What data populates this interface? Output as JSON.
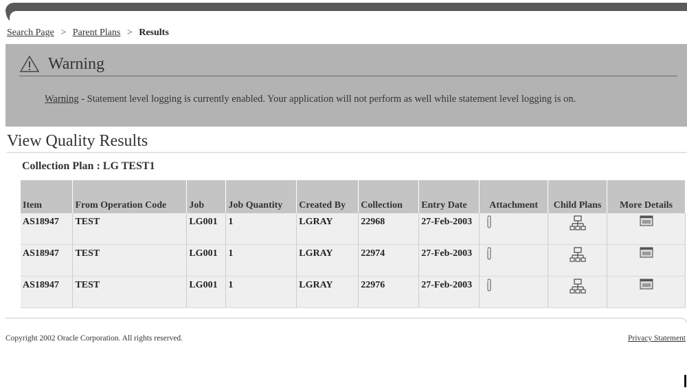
{
  "breadcrumb": {
    "items": [
      "Search Page",
      "Parent Plans"
    ],
    "separator": ">",
    "current": "Results"
  },
  "warning": {
    "title": "Warning",
    "label": "Warning",
    "message": " - Statement level logging is currently enabled. Your application will not perform as well while statement level logging is on."
  },
  "page": {
    "title": "View Quality Results",
    "subtitle": "Collection Plan : LG TEST1"
  },
  "table": {
    "headers": [
      "Item",
      "From Operation Code",
      "Job",
      "Job Quantity",
      "Created By",
      "Collection",
      "Entry Date",
      "Attachment",
      "Child Plans",
      "More Details"
    ],
    "rows": [
      {
        "item": "AS18947",
        "op_code": "TEST",
        "job": "LG001",
        "qty": "1",
        "created_by": "LGRAY",
        "collection": "22968",
        "entry_date": "27-Feb-2003"
      },
      {
        "item": "AS18947",
        "op_code": "TEST",
        "job": "LG001",
        "qty": "1",
        "created_by": "LGRAY",
        "collection": "22974",
        "entry_date": "27-Feb-2003"
      },
      {
        "item": "AS18947",
        "op_code": "TEST",
        "job": "LG001",
        "qty": "1",
        "created_by": "LGRAY",
        "collection": "22976",
        "entry_date": "27-Feb-2003"
      }
    ]
  },
  "footer": {
    "copyright": "Copyright 2002 Oracle Corporation. All rights reserved.",
    "privacy": "Privacy Statement"
  },
  "colors": {
    "warning_bg": "#b3b3b3",
    "header_bg": "#c4c4c4",
    "row_bg": "#efefef",
    "topbar": "#5a5a5a"
  }
}
